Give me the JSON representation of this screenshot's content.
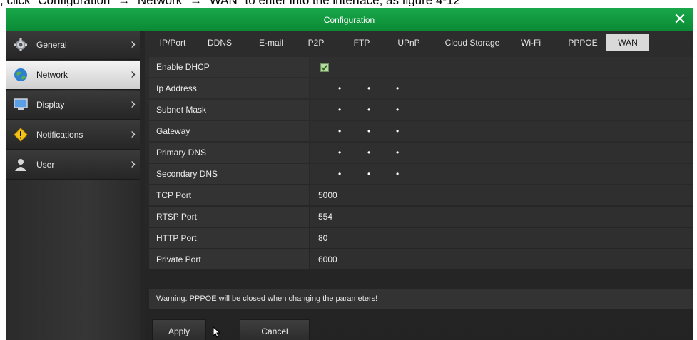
{
  "caption": ", click \"Configuration\" → \"Network\" → \"WAN\" to enter into the interface, as figure 4-12",
  "window": {
    "title": "Configuration"
  },
  "sidebar": {
    "items": [
      {
        "label": "General",
        "icon": "gear-icon"
      },
      {
        "label": "Network",
        "icon": "globe-icon"
      },
      {
        "label": "Display",
        "icon": "monitor-icon"
      },
      {
        "label": "Notifications",
        "icon": "warning-icon"
      },
      {
        "label": "User",
        "icon": "user-icon"
      }
    ],
    "active_index": 1
  },
  "tabs": [
    "IP/Port",
    "DDNS",
    "E-mail",
    "P2P",
    "FTP",
    "UPnP",
    "Cloud Storage",
    "Wi-Fi",
    "PPPOE",
    "WAN"
  ],
  "active_tab": "WAN",
  "fields": {
    "enable_dhcp": {
      "label": "Enable DHCP",
      "checked": true
    },
    "ip_address": {
      "label": "Ip Address"
    },
    "subnet_mask": {
      "label": "Subnet Mask"
    },
    "gateway": {
      "label": "Gateway"
    },
    "primary_dns": {
      "label": "Primary DNS"
    },
    "secondary_dns": {
      "label": "Secondary DNS"
    },
    "tcp_port": {
      "label": "TCP Port",
      "value": "5000"
    },
    "rtsp_port": {
      "label": "RTSP Port",
      "value": "554"
    },
    "http_port": {
      "label": "HTTP Port",
      "value": "80"
    },
    "private_port": {
      "label": "Private Port",
      "value": "6000"
    }
  },
  "ip_separator": "•",
  "warning": "Warning: PPPOE will be closed when changing the parameters!",
  "buttons": {
    "apply": "Apply",
    "cancel": "Cancel"
  },
  "colors": {
    "titlebar": "#0b8a35",
    "active_tab": "#d9d9d9"
  }
}
